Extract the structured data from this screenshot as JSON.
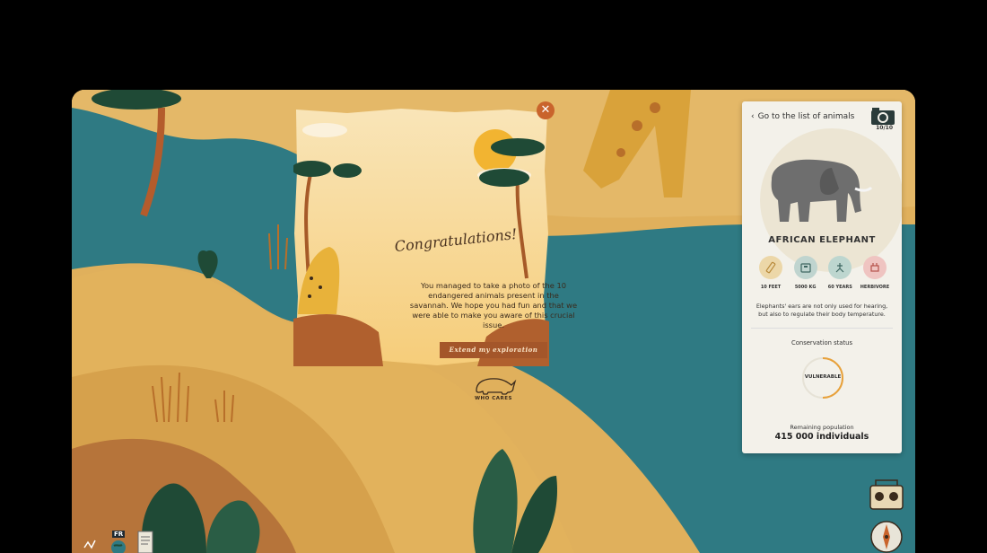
{
  "panel": {
    "back_label": "Go to the list of animals",
    "photo_count": "10/10",
    "animal_name": "AFRICAN ELEPHANT",
    "stats": [
      {
        "label": "10 FEET",
        "icon": "height-icon",
        "color": "#ecd7a8"
      },
      {
        "label": "5000 KG",
        "icon": "weight-icon",
        "color": "#bfd4cf"
      },
      {
        "label": "60 YEARS",
        "icon": "lifespan-icon",
        "color": "#bdd6cf"
      },
      {
        "label": "HERBIVORE",
        "icon": "diet-icon",
        "color": "#efc4c1"
      }
    ],
    "description": "Elephants' ears are not only used for hearing, but also to regulate their body temperature.",
    "conservation_title": "Conservation status",
    "conservation_status": "VULNERABLE",
    "population_label": "Remaining population",
    "population_value": "415 000 individuals"
  },
  "modal": {
    "title": "Congratulations!",
    "message": "You managed to take a photo of the 10 endangered animals present in the savannah. We hope you had fun and that we were able to make you aware of this crucial issue.",
    "extend_label": "Extend my exploration",
    "logo_text": "WHO CARES"
  },
  "bottom": {
    "language": "FR"
  },
  "colors": {
    "sand": "#e2b25c",
    "water": "#2f7a83",
    "accent": "#c9642c",
    "panel": "#f3f1ea"
  }
}
